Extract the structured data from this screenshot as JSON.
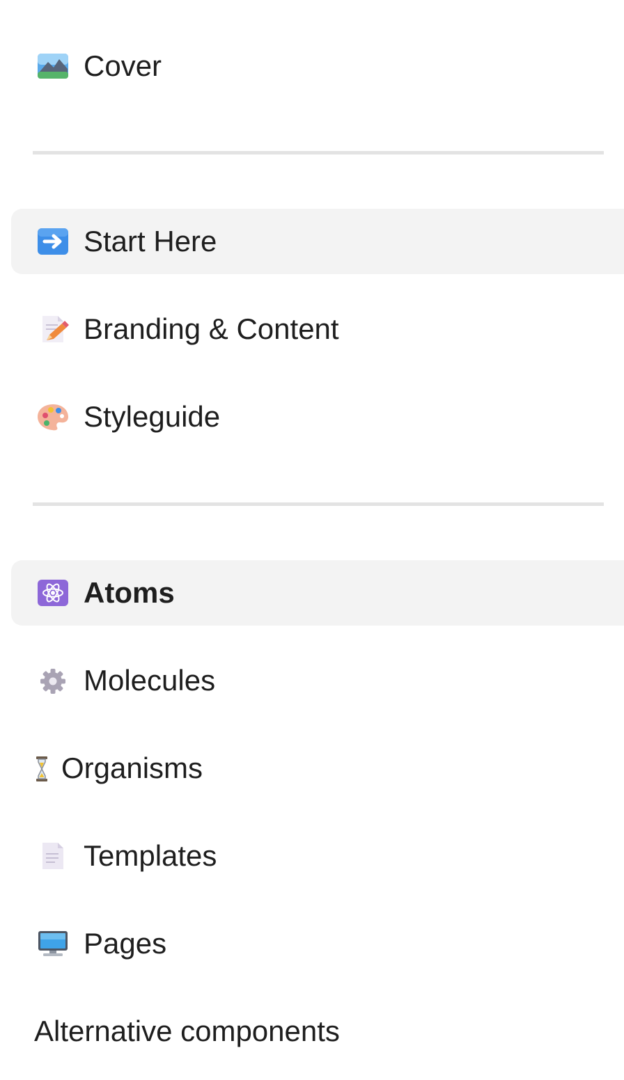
{
  "pages": {
    "cover": {
      "label": "Cover",
      "icon": "landscape-picture-icon"
    },
    "start_here": {
      "label": "Start Here",
      "icon": "right-arrow-icon"
    },
    "branding": {
      "label": "Branding & Content",
      "icon": "memo-pencil-icon"
    },
    "styleguide": {
      "label": "Styleguide",
      "icon": "artist-palette-icon"
    },
    "atoms": {
      "label": "Atoms",
      "icon": "atom-symbol-icon"
    },
    "molecules": {
      "label": "Molecules",
      "icon": "gear-icon"
    },
    "organisms": {
      "label": "Organisms",
      "icon": "hourglass-icon"
    },
    "templates": {
      "label": "Templates",
      "icon": "page-facing-up-icon"
    },
    "pages": {
      "label": "Pages",
      "icon": "desktop-computer-icon"
    },
    "alternative": {
      "label": "Alternative components"
    }
  },
  "colors": {
    "highlight": "#f3f3f3",
    "divider": "#e3e3e3",
    "text": "#1e1e1e"
  }
}
